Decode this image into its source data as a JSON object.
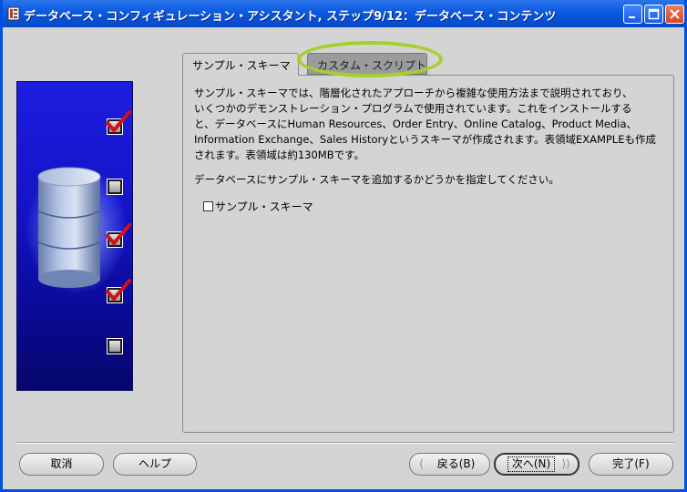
{
  "window": {
    "title": "データベース・コンフィギュレーション・アシスタント, ステップ9/12：データベース・コンテンツ"
  },
  "tabs": [
    {
      "label": "サンプル・スキーマ",
      "active": true
    },
    {
      "label": "カスタム・スクリプト",
      "active": false,
      "highlighted": true
    }
  ],
  "content": {
    "description_lines": [
      "サンプル・スキーマでは、階層化されたアプローチから複雑な使用方法まで説明されており、",
      "いくつかのデモンストレーション・プログラムで使用されています。これをインストールする",
      "と、データベースにHuman Resources、Order Entry、Online Catalog、Product Media、",
      "Information Exchange、Sales Historyというスキーマが作成されます。表領域EXAMPLEも作成",
      "されます。表領域は約130MBです。"
    ],
    "prompt": "データベースにサンプル・スキーマを追加するかどうかを指定してください。",
    "checkbox": {
      "label": "サンプル・スキーマ",
      "checked": false
    }
  },
  "side_steps": [
    {
      "checked": true
    },
    {
      "checked": false
    },
    {
      "checked": true
    },
    {
      "checked": true
    },
    {
      "checked": false
    }
  ],
  "buttons": {
    "cancel": "取消",
    "help": "ヘルプ",
    "back": "戻る(B)",
    "next": "次へ(N)",
    "finish": "完了(F)"
  },
  "colors": {
    "titlebar": "#0a5ae0",
    "highlight_ring": "#a6cf2a",
    "check": "#d0101a",
    "side_panel": "#1414c8"
  }
}
